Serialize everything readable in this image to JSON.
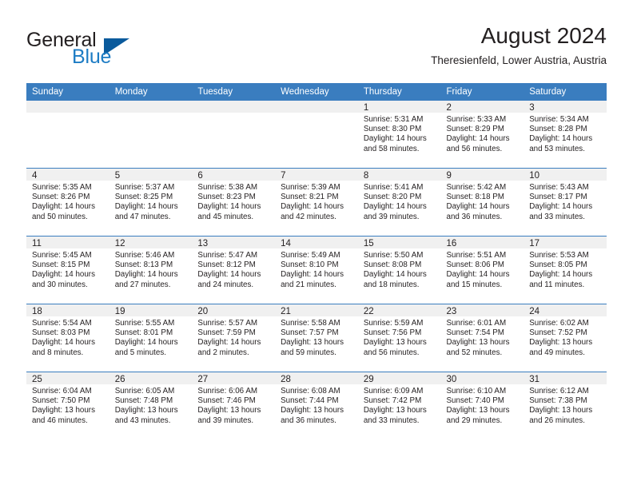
{
  "brand": {
    "name_part1": "General",
    "name_part2": "Blue",
    "accent_color": "#1d7cc4",
    "triangle_color": "#0a5a9c"
  },
  "header": {
    "title": "August 2024",
    "subtitle": "Theresienfeld, Lower Austria, Austria"
  },
  "calendar": {
    "header_bg": "#3a7dbf",
    "daynum_bg": "#f0f0f0",
    "weekdays": [
      "Sunday",
      "Monday",
      "Tuesday",
      "Wednesday",
      "Thursday",
      "Friday",
      "Saturday"
    ],
    "weeks": [
      [
        {
          "day": "",
          "empty": true
        },
        {
          "day": "",
          "empty": true
        },
        {
          "day": "",
          "empty": true
        },
        {
          "day": "",
          "empty": true
        },
        {
          "day": "1",
          "l1": "Sunrise: 5:31 AM",
          "l2": "Sunset: 8:30 PM",
          "l3": "Daylight: 14 hours",
          "l4": "and 58 minutes."
        },
        {
          "day": "2",
          "l1": "Sunrise: 5:33 AM",
          "l2": "Sunset: 8:29 PM",
          "l3": "Daylight: 14 hours",
          "l4": "and 56 minutes."
        },
        {
          "day": "3",
          "l1": "Sunrise: 5:34 AM",
          "l2": "Sunset: 8:28 PM",
          "l3": "Daylight: 14 hours",
          "l4": "and 53 minutes."
        }
      ],
      [
        {
          "day": "4",
          "l1": "Sunrise: 5:35 AM",
          "l2": "Sunset: 8:26 PM",
          "l3": "Daylight: 14 hours",
          "l4": "and 50 minutes."
        },
        {
          "day": "5",
          "l1": "Sunrise: 5:37 AM",
          "l2": "Sunset: 8:25 PM",
          "l3": "Daylight: 14 hours",
          "l4": "and 47 minutes."
        },
        {
          "day": "6",
          "l1": "Sunrise: 5:38 AM",
          "l2": "Sunset: 8:23 PM",
          "l3": "Daylight: 14 hours",
          "l4": "and 45 minutes."
        },
        {
          "day": "7",
          "l1": "Sunrise: 5:39 AM",
          "l2": "Sunset: 8:21 PM",
          "l3": "Daylight: 14 hours",
          "l4": "and 42 minutes."
        },
        {
          "day": "8",
          "l1": "Sunrise: 5:41 AM",
          "l2": "Sunset: 8:20 PM",
          "l3": "Daylight: 14 hours",
          "l4": "and 39 minutes."
        },
        {
          "day": "9",
          "l1": "Sunrise: 5:42 AM",
          "l2": "Sunset: 8:18 PM",
          "l3": "Daylight: 14 hours",
          "l4": "and 36 minutes."
        },
        {
          "day": "10",
          "l1": "Sunrise: 5:43 AM",
          "l2": "Sunset: 8:17 PM",
          "l3": "Daylight: 14 hours",
          "l4": "and 33 minutes."
        }
      ],
      [
        {
          "day": "11",
          "l1": "Sunrise: 5:45 AM",
          "l2": "Sunset: 8:15 PM",
          "l3": "Daylight: 14 hours",
          "l4": "and 30 minutes."
        },
        {
          "day": "12",
          "l1": "Sunrise: 5:46 AM",
          "l2": "Sunset: 8:13 PM",
          "l3": "Daylight: 14 hours",
          "l4": "and 27 minutes."
        },
        {
          "day": "13",
          "l1": "Sunrise: 5:47 AM",
          "l2": "Sunset: 8:12 PM",
          "l3": "Daylight: 14 hours",
          "l4": "and 24 minutes."
        },
        {
          "day": "14",
          "l1": "Sunrise: 5:49 AM",
          "l2": "Sunset: 8:10 PM",
          "l3": "Daylight: 14 hours",
          "l4": "and 21 minutes."
        },
        {
          "day": "15",
          "l1": "Sunrise: 5:50 AM",
          "l2": "Sunset: 8:08 PM",
          "l3": "Daylight: 14 hours",
          "l4": "and 18 minutes."
        },
        {
          "day": "16",
          "l1": "Sunrise: 5:51 AM",
          "l2": "Sunset: 8:06 PM",
          "l3": "Daylight: 14 hours",
          "l4": "and 15 minutes."
        },
        {
          "day": "17",
          "l1": "Sunrise: 5:53 AM",
          "l2": "Sunset: 8:05 PM",
          "l3": "Daylight: 14 hours",
          "l4": "and 11 minutes."
        }
      ],
      [
        {
          "day": "18",
          "l1": "Sunrise: 5:54 AM",
          "l2": "Sunset: 8:03 PM",
          "l3": "Daylight: 14 hours",
          "l4": "and 8 minutes."
        },
        {
          "day": "19",
          "l1": "Sunrise: 5:55 AM",
          "l2": "Sunset: 8:01 PM",
          "l3": "Daylight: 14 hours",
          "l4": "and 5 minutes."
        },
        {
          "day": "20",
          "l1": "Sunrise: 5:57 AM",
          "l2": "Sunset: 7:59 PM",
          "l3": "Daylight: 14 hours",
          "l4": "and 2 minutes."
        },
        {
          "day": "21",
          "l1": "Sunrise: 5:58 AM",
          "l2": "Sunset: 7:57 PM",
          "l3": "Daylight: 13 hours",
          "l4": "and 59 minutes."
        },
        {
          "day": "22",
          "l1": "Sunrise: 5:59 AM",
          "l2": "Sunset: 7:56 PM",
          "l3": "Daylight: 13 hours",
          "l4": "and 56 minutes."
        },
        {
          "day": "23",
          "l1": "Sunrise: 6:01 AM",
          "l2": "Sunset: 7:54 PM",
          "l3": "Daylight: 13 hours",
          "l4": "and 52 minutes."
        },
        {
          "day": "24",
          "l1": "Sunrise: 6:02 AM",
          "l2": "Sunset: 7:52 PM",
          "l3": "Daylight: 13 hours",
          "l4": "and 49 minutes."
        }
      ],
      [
        {
          "day": "25",
          "l1": "Sunrise: 6:04 AM",
          "l2": "Sunset: 7:50 PM",
          "l3": "Daylight: 13 hours",
          "l4": "and 46 minutes."
        },
        {
          "day": "26",
          "l1": "Sunrise: 6:05 AM",
          "l2": "Sunset: 7:48 PM",
          "l3": "Daylight: 13 hours",
          "l4": "and 43 minutes."
        },
        {
          "day": "27",
          "l1": "Sunrise: 6:06 AM",
          "l2": "Sunset: 7:46 PM",
          "l3": "Daylight: 13 hours",
          "l4": "and 39 minutes."
        },
        {
          "day": "28",
          "l1": "Sunrise: 6:08 AM",
          "l2": "Sunset: 7:44 PM",
          "l3": "Daylight: 13 hours",
          "l4": "and 36 minutes."
        },
        {
          "day": "29",
          "l1": "Sunrise: 6:09 AM",
          "l2": "Sunset: 7:42 PM",
          "l3": "Daylight: 13 hours",
          "l4": "and 33 minutes."
        },
        {
          "day": "30",
          "l1": "Sunrise: 6:10 AM",
          "l2": "Sunset: 7:40 PM",
          "l3": "Daylight: 13 hours",
          "l4": "and 29 minutes."
        },
        {
          "day": "31",
          "l1": "Sunrise: 6:12 AM",
          "l2": "Sunset: 7:38 PM",
          "l3": "Daylight: 13 hours",
          "l4": "and 26 minutes."
        }
      ]
    ]
  }
}
